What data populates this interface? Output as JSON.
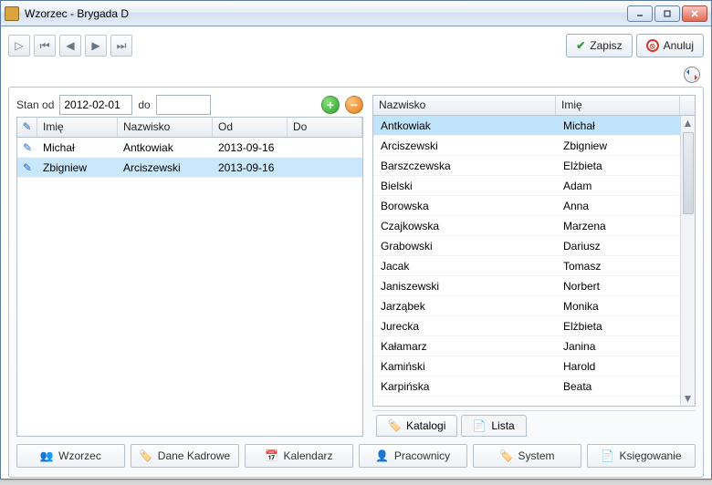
{
  "window": {
    "title": "Wzorzec - Brygada D"
  },
  "actions": {
    "save": "Zapisz",
    "cancel": "Anuluj"
  },
  "filter": {
    "label_from": "Stan od",
    "date_from": "2012-02-01",
    "label_to": "do",
    "date_to": ""
  },
  "left_grid": {
    "headers": {
      "imie": "Imię",
      "nazwisko": "Nazwisko",
      "od": "Od",
      "do": "Do"
    },
    "rows": [
      {
        "imie": "Michał",
        "nazwisko": "Antkowiak",
        "od": "2013-09-16",
        "do": ""
      },
      {
        "imie": "Zbigniew",
        "nazwisko": "Arciszewski",
        "od": "2013-09-16",
        "do": ""
      }
    ],
    "selected_index": 1
  },
  "right_grid": {
    "headers": {
      "nazwisko": "Nazwisko",
      "imie": "Imię"
    },
    "rows": [
      {
        "nazwisko": "Antkowiak",
        "imie": "Michał"
      },
      {
        "nazwisko": "Arciszewski",
        "imie": "Zbigniew"
      },
      {
        "nazwisko": "Barszczewska",
        "imie": "Elżbieta"
      },
      {
        "nazwisko": "Bielski",
        "imie": "Adam"
      },
      {
        "nazwisko": "Borowska",
        "imie": "Anna"
      },
      {
        "nazwisko": "Czajkowska",
        "imie": "Marzena"
      },
      {
        "nazwisko": "Grabowski",
        "imie": "Dariusz"
      },
      {
        "nazwisko": "Jacak",
        "imie": "Tomasz"
      },
      {
        "nazwisko": "Janiszewski",
        "imie": "Norbert"
      },
      {
        "nazwisko": "Jarząbek",
        "imie": "Monika"
      },
      {
        "nazwisko": "Jurecka",
        "imie": "Elżbieta"
      },
      {
        "nazwisko": "Kałamarz",
        "imie": "Janina"
      },
      {
        "nazwisko": "Kamiński",
        "imie": "Harold"
      },
      {
        "nazwisko": "Karpińska",
        "imie": "Beata"
      }
    ],
    "selected_index": 0
  },
  "right_tabs": {
    "katalogi": "Katalogi",
    "lista": "Lista"
  },
  "bottom_tabs": {
    "wzorzec": "Wzorzec",
    "dane_kadrowe": "Dane Kadrowe",
    "kalendarz": "Kalendarz",
    "pracownicy": "Pracownicy",
    "system": "System",
    "ksiegowanie": "Księgowanie"
  }
}
